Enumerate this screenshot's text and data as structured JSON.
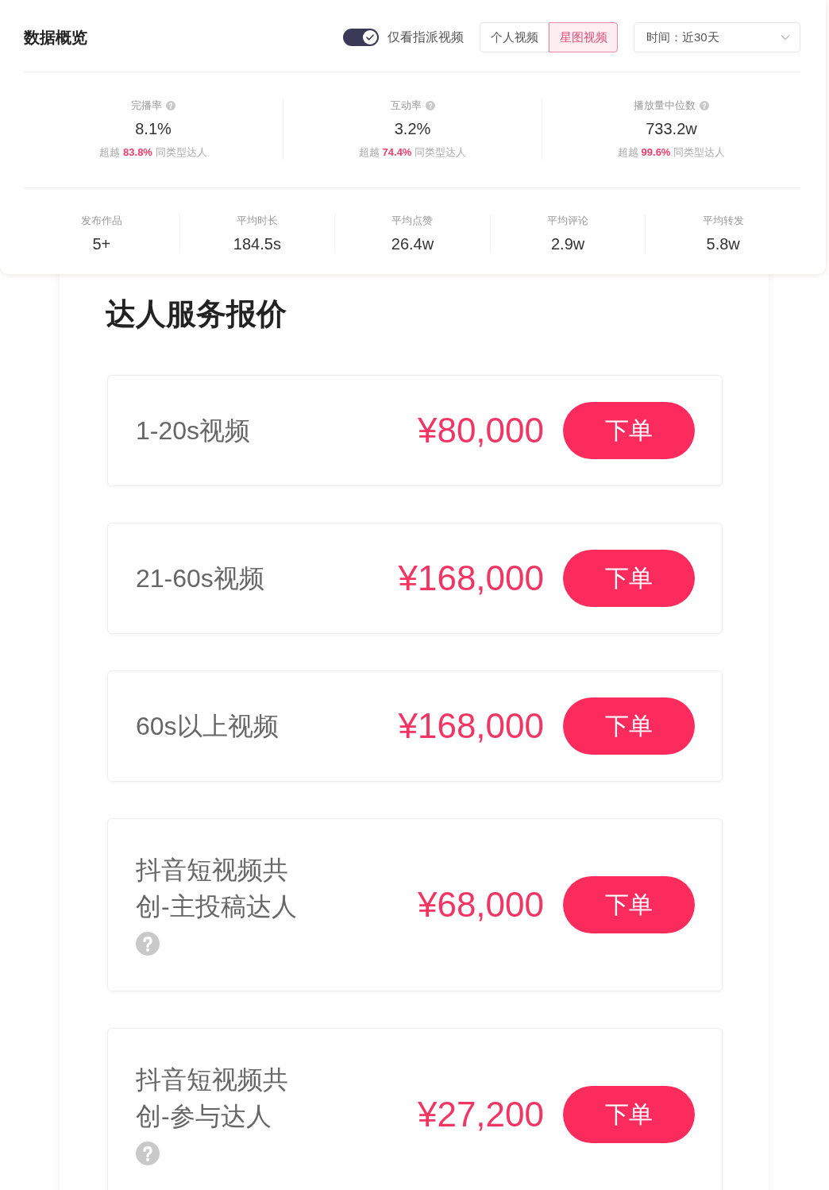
{
  "overview": {
    "title": "数据概览",
    "toggle": {
      "label": "仅看指派视频",
      "on": true
    },
    "segments": [
      {
        "label": "个人视频",
        "selected": false
      },
      {
        "label": "星图视频",
        "selected": true
      }
    ],
    "time_select": {
      "value": "时间：近30天"
    },
    "metrics": [
      {
        "label": "完播率",
        "value": "8.1%",
        "comparison": "超越 **83.8%** 同类型达人"
      },
      {
        "label": "互动率",
        "value": "3.2%",
        "comparison": "超越 **74.4%** 同类型达人"
      },
      {
        "label": "播放量中位数",
        "value": "733.2w",
        "comparison": "超越 **99.6%** 同类型达人"
      }
    ],
    "stats": [
      {
        "label": "发布作品",
        "value": "5+"
      },
      {
        "label": "平均时长",
        "value": "184.5s"
      },
      {
        "label": "平均点赞",
        "value": "26.4w"
      },
      {
        "label": "平均评论",
        "value": "2.9w"
      },
      {
        "label": "平均转发",
        "value": "5.8w"
      }
    ]
  },
  "pricing": {
    "title": "达人服务报价",
    "items": [
      {
        "name": "1-20s视频",
        "help": false,
        "price": "¥80,000",
        "button": "下单"
      },
      {
        "name": "21-60s视频",
        "help": false,
        "price": "¥168,000",
        "button": "下单"
      },
      {
        "name": "60s以上视频",
        "help": false,
        "price": "¥168,000",
        "button": "下单"
      },
      {
        "name": "抖音短视频共创-主投稿达人",
        "help": true,
        "price": "¥68,000",
        "button": "下单"
      },
      {
        "name": "抖音短视频共创-参与达人",
        "help": true,
        "price": "¥27,200",
        "button": "下单"
      }
    ]
  }
}
